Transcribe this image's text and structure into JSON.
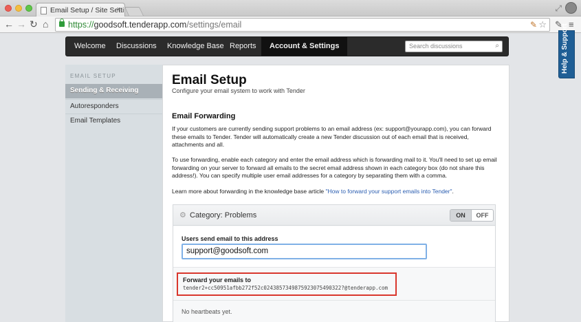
{
  "browser": {
    "tab_title": "Email Setup / Site Settings",
    "tab_close": "×",
    "url_scheme": "https://",
    "url_host": "goodsoft.tenderapp.com",
    "url_path": "/settings/email"
  },
  "help_tab": "Help & Support",
  "nav": {
    "items": [
      "Welcome",
      "Discussions",
      "Knowledge Base",
      "Reports",
      "Account & Settings"
    ],
    "active": "Account & Settings",
    "search_placeholder": "Search discussions"
  },
  "sidebar": {
    "heading": "EMAIL SETUP",
    "items": [
      "Sending & Receiving",
      "Autoresponders",
      "Email Templates"
    ],
    "active": "Sending & Receiving"
  },
  "main": {
    "title": "Email Setup",
    "subtitle": "Configure your email system to work with Tender",
    "section_title": "Email Forwarding",
    "para1": "If your customers are currently sending support problems to an email address (ex: support@yourapp.com), you can forward these emails to Tender. Tender will automatically create a new Tender discussion out of each email that is received, attachments and all.",
    "para2": "To use forwarding, enable each category and enter the email address which is forwarding mail to it. You'll need to set up email forwarding on your server to forward all emails to the secret email address shown in each category box (do not share this address!). You can specify multiple user email addresses for a category by separating them with a comma.",
    "para3_prefix": "Learn more about forwarding in the knowledge base article ",
    "para3_link": "\"How to forward your support emails into Tender\"",
    "para3_suffix": "."
  },
  "category": {
    "title": "Category: Problems",
    "toggle_on": "ON",
    "toggle_off": "OFF",
    "toggle_state": "on",
    "field_label": "Users send email to this address",
    "field_value": "support@goodsoft.com",
    "forward_label": "Forward your emails to",
    "forward_address": "tender2+cc50951afbb272f52c0243857349875923075490322?@tenderapp.com",
    "heartbeats": "No heartbeats yet."
  }
}
